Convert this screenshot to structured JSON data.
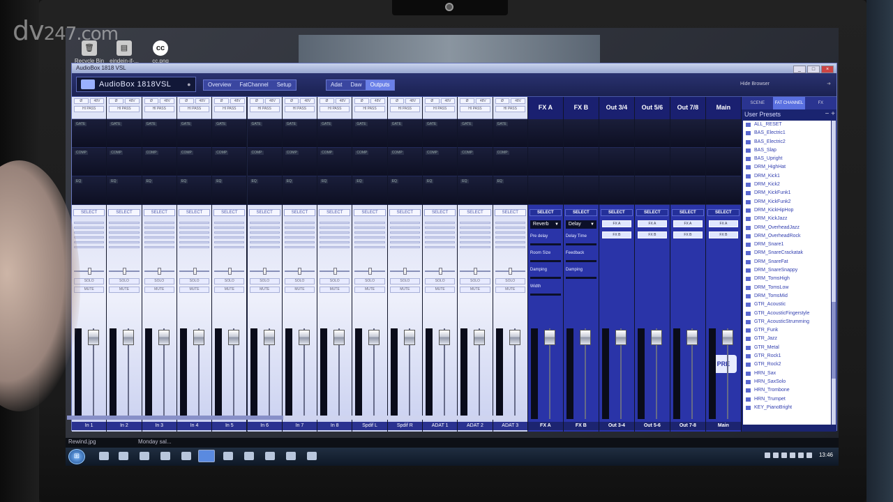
{
  "watermark": {
    "logo": "dv",
    "dotcom": "247.com"
  },
  "desktop_icons": [
    {
      "label": "Recycle Bin",
      "glyph": "🗑"
    },
    {
      "label": "eindein-if-...",
      "glyph": "▤"
    },
    {
      "label": "cc.png",
      "glyph": "cc"
    }
  ],
  "window": {
    "title": "AudioBox 1818 VSL",
    "controls": [
      "_",
      "□",
      "×"
    ]
  },
  "toolbar": {
    "brand": "AudioBox 1818VSL",
    "nav_left": [
      "Overview",
      "FatChannel",
      "Setup"
    ],
    "nav_right": [
      "Adat",
      "Daw",
      "Outputs"
    ],
    "browser_label": "Hide Browser"
  },
  "strip_labels": {
    "polarity": "Ø",
    "phantom": "48V",
    "hipass": "HI PASS",
    "gate": "GATE",
    "comp": "COMP",
    "eq": "EQ",
    "select": "SELECT",
    "solo": "SOLO",
    "mute": "MUTE"
  },
  "input_channels": [
    "In 1",
    "In 2",
    "In 3",
    "In 4",
    "In 5",
    "In 6",
    "In 7",
    "In 8",
    "Spdif L",
    "Spdif R",
    "ADAT 1",
    "ADAT 2",
    "ADAT 3"
  ],
  "output_channels": [
    {
      "name": "FX A",
      "label": "FX A"
    },
    {
      "name": "FX B",
      "label": "FX B"
    },
    {
      "name": "Out 3/4",
      "label": "Out 3-4"
    },
    {
      "name": "Out 5/6",
      "label": "Out 5-6"
    },
    {
      "name": "Out 7/8",
      "label": "Out 7-8"
    },
    {
      "name": "Main",
      "label": "Main"
    }
  ],
  "fx_a": {
    "type": "Reverb",
    "params": [
      "Pre delay",
      "Room Size",
      "Damping",
      "Width"
    ]
  },
  "fx_b": {
    "type": "Delay",
    "params": [
      "Delay Time",
      "Feedback",
      "Damping"
    ]
  },
  "fx_sends": [
    "FX A",
    "FX B"
  ],
  "right_panel": {
    "tabs": [
      "SCENE",
      "FAT CHANNEL",
      "FX"
    ],
    "active_tab": "FAT CHANNEL",
    "title": "User Presets",
    "presets": [
      "ALL_RESET",
      "BAS_Electric1",
      "BAS_Electric2",
      "BAS_Slap",
      "BAS_Upright",
      "DRM_HighHat",
      "DRM_Kick1",
      "DRM_Kick2",
      "DRM_KickFunk1",
      "DRM_KickFunk2",
      "DRM_KickHipHop",
      "DRM_KickJazz",
      "DRM_OverheadJazz",
      "DRM_OverheadRock",
      "DRM_Snare1",
      "DRM_SnareCrackatak",
      "DRM_SnareFat",
      "DRM_SnareSnappy",
      "DRM_TomsHigh",
      "DRM_TomsLow",
      "DRM_TomsMid",
      "GTR_Acoustic",
      "GTR_AcousticFingerstyle",
      "GTR_AcousticStrumming",
      "GTR_Funk",
      "GTR_Jazz",
      "GTR_Metal",
      "GTR_Rock1",
      "GTR_Rock2",
      "HRN_Sax",
      "HRN_SaxSolo",
      "HRN_Trombone",
      "HRN_Trumpet",
      "KEY_PianoBright"
    ]
  },
  "taskbar": {
    "files": [
      "Rewind.jpg",
      "Monday sal..."
    ],
    "clock": "13:46",
    "start": "⊞"
  },
  "colors": {
    "accent": "#2a34a8",
    "panel": "#1d2340",
    "strip": "#c9d0f0"
  }
}
